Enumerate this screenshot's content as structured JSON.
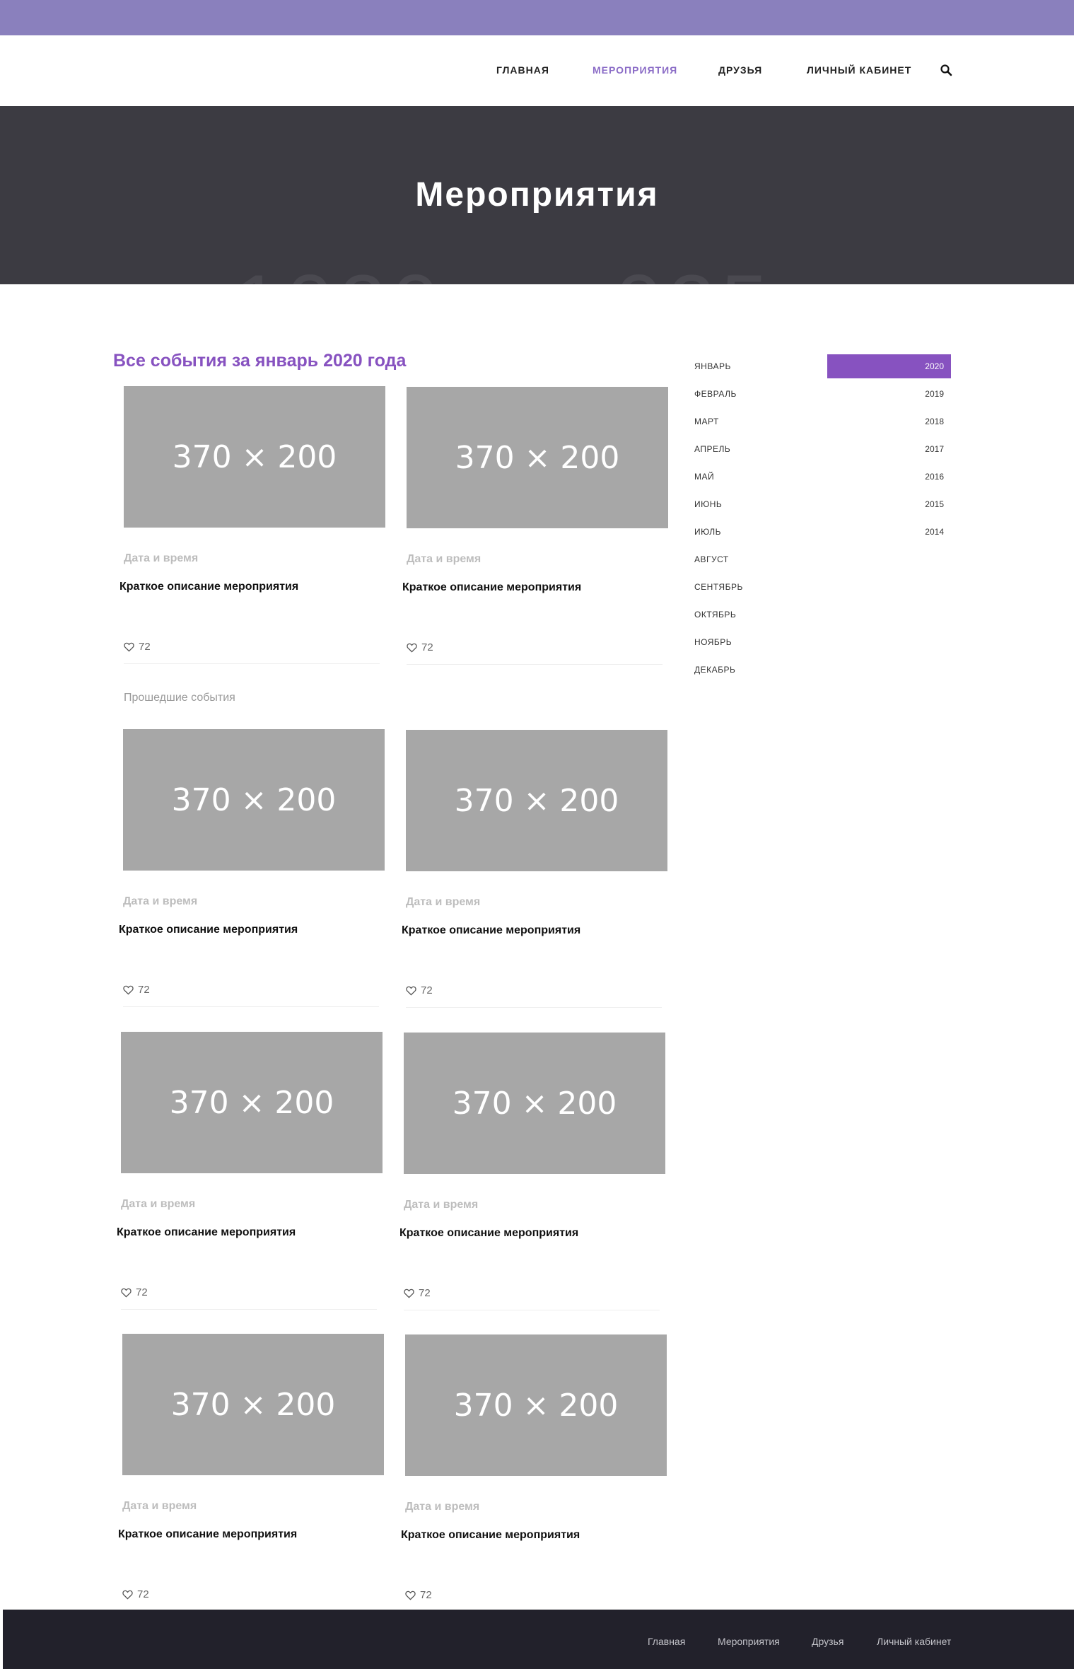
{
  "nav": {
    "items": [
      {
        "label": "ГЛАВНАЯ"
      },
      {
        "label": "МЕРОПРИЯТИЯ"
      },
      {
        "label": "ДРУЗЬЯ"
      },
      {
        "label": "ЛИЧНЫЙ КАБИНЕТ"
      }
    ],
    "active_item": "МЕРОПРИЯТИЯ",
    "search_icon": "search-icon"
  },
  "hero": {
    "title": "Мероприятия"
  },
  "main": {
    "heading": "Все события за январь 2020 года",
    "past_label": "Прошедшие события",
    "card_placeholder": "370 × 200",
    "card_date": "Дата и время",
    "card_description": "Краткое описание мероприятия",
    "card_likes": "72",
    "like_icon": "heart-icon"
  },
  "sidebar": {
    "months": [
      "ЯНВАРЬ",
      "ФЕВРАЛЬ",
      "МАРТ",
      "АПРЕЛЬ",
      "МАЙ",
      "ИЮНЬ",
      "ИЮЛЬ",
      "АВГУСТ",
      "СЕНТЯБРЬ",
      "ОКТЯБРЬ",
      "НОЯБРЬ",
      "ДЕКАБРЬ"
    ],
    "years": [
      "2020",
      "2019",
      "2018",
      "2017",
      "2016",
      "2015",
      "2014"
    ],
    "active_year": "2020",
    "active_color": "#8752c0"
  },
  "footer": {
    "links": [
      "Главная",
      "Мероприятия",
      "Друзья",
      "Личный кабинет"
    ]
  },
  "colors": {
    "topbar": "#8a80bd",
    "hero_bg": "#3c3b42",
    "accent": "#8752c0",
    "footer_bg": "#22212b"
  }
}
